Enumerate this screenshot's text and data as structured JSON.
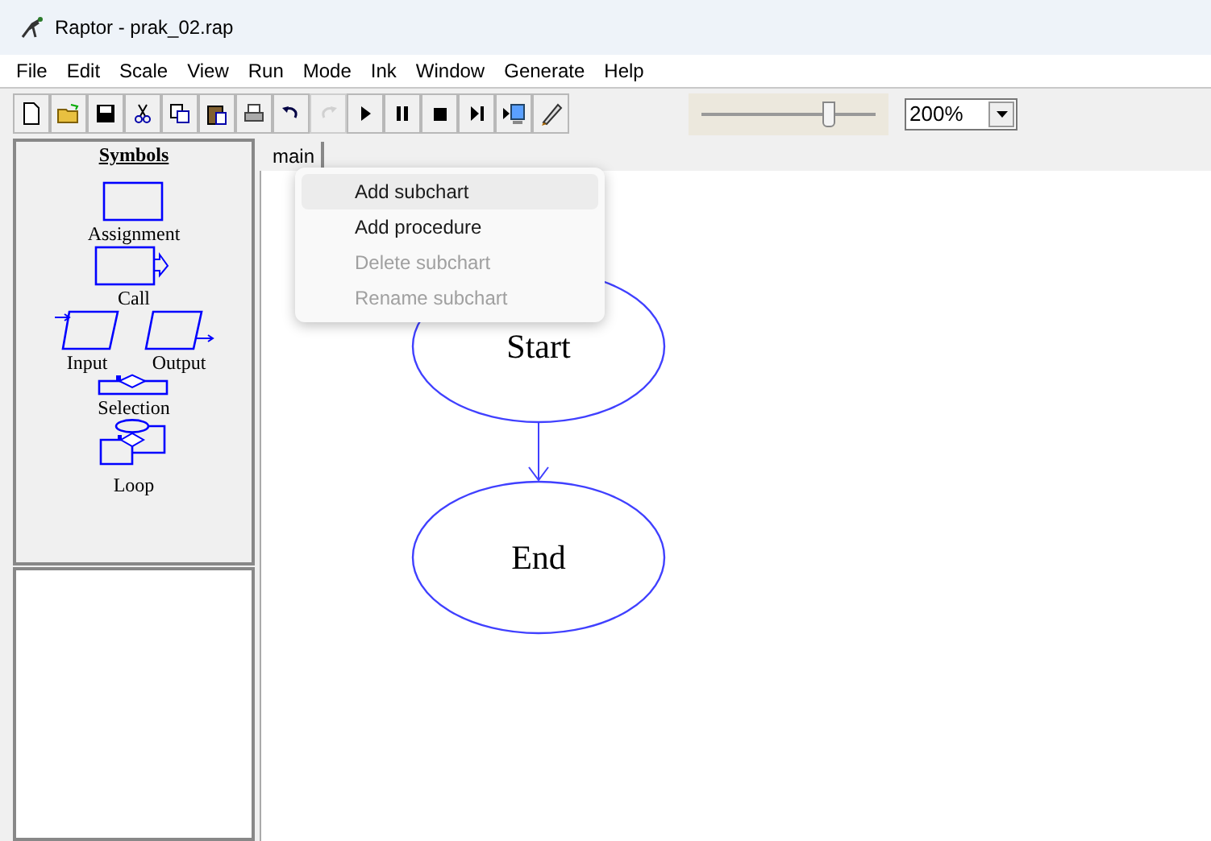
{
  "window": {
    "title": "Raptor - prak_02.rap"
  },
  "menu": [
    "File",
    "Edit",
    "Scale",
    "View",
    "Run",
    "Mode",
    "Ink",
    "Window",
    "Generate",
    "Help"
  ],
  "toolbar": [
    {
      "kind": "new",
      "disabled": false
    },
    {
      "kind": "open",
      "disabled": false
    },
    {
      "kind": "save",
      "disabled": false
    },
    {
      "kind": "cut",
      "disabled": false
    },
    {
      "kind": "copy",
      "disabled": false
    },
    {
      "kind": "paste",
      "disabled": false
    },
    {
      "kind": "print",
      "disabled": false
    },
    {
      "kind": "undo",
      "disabled": false
    },
    {
      "kind": "redo",
      "disabled": true
    },
    {
      "kind": "play",
      "disabled": false
    },
    {
      "kind": "pause",
      "disabled": false
    },
    {
      "kind": "stop",
      "disabled": false
    },
    {
      "kind": "step",
      "disabled": false
    },
    {
      "kind": "server",
      "disabled": false
    },
    {
      "kind": "pen",
      "disabled": false
    }
  ],
  "speed_slider": {
    "level": 0.73
  },
  "zoom": {
    "value": "200%"
  },
  "symbols": {
    "title": "Symbols",
    "rows": [
      {
        "items": [
          {
            "kind": "assignment",
            "label": "Assignment"
          }
        ]
      },
      {
        "items": [
          {
            "kind": "call",
            "label": "Call"
          }
        ]
      },
      {
        "items": [
          {
            "kind": "input",
            "label": "Input"
          },
          {
            "kind": "output",
            "label": "Output"
          }
        ]
      },
      {
        "items": [
          {
            "kind": "selection",
            "label": "Selection"
          }
        ]
      },
      {
        "items": [
          {
            "kind": "loop",
            "label": "Loop"
          }
        ]
      }
    ]
  },
  "tabs": [
    {
      "label": "main",
      "selected": true
    }
  ],
  "context_menu": [
    {
      "label": "Add subchart",
      "selected": true,
      "disabled": false
    },
    {
      "label": "Add procedure",
      "selected": false,
      "disabled": false
    },
    {
      "label": "Delete subchart",
      "selected": false,
      "disabled": true
    },
    {
      "label": "Rename subchart",
      "selected": false,
      "disabled": true
    }
  ],
  "flowchart": {
    "nodes": [
      {
        "label": "Start"
      },
      {
        "label": "End"
      }
    ]
  }
}
